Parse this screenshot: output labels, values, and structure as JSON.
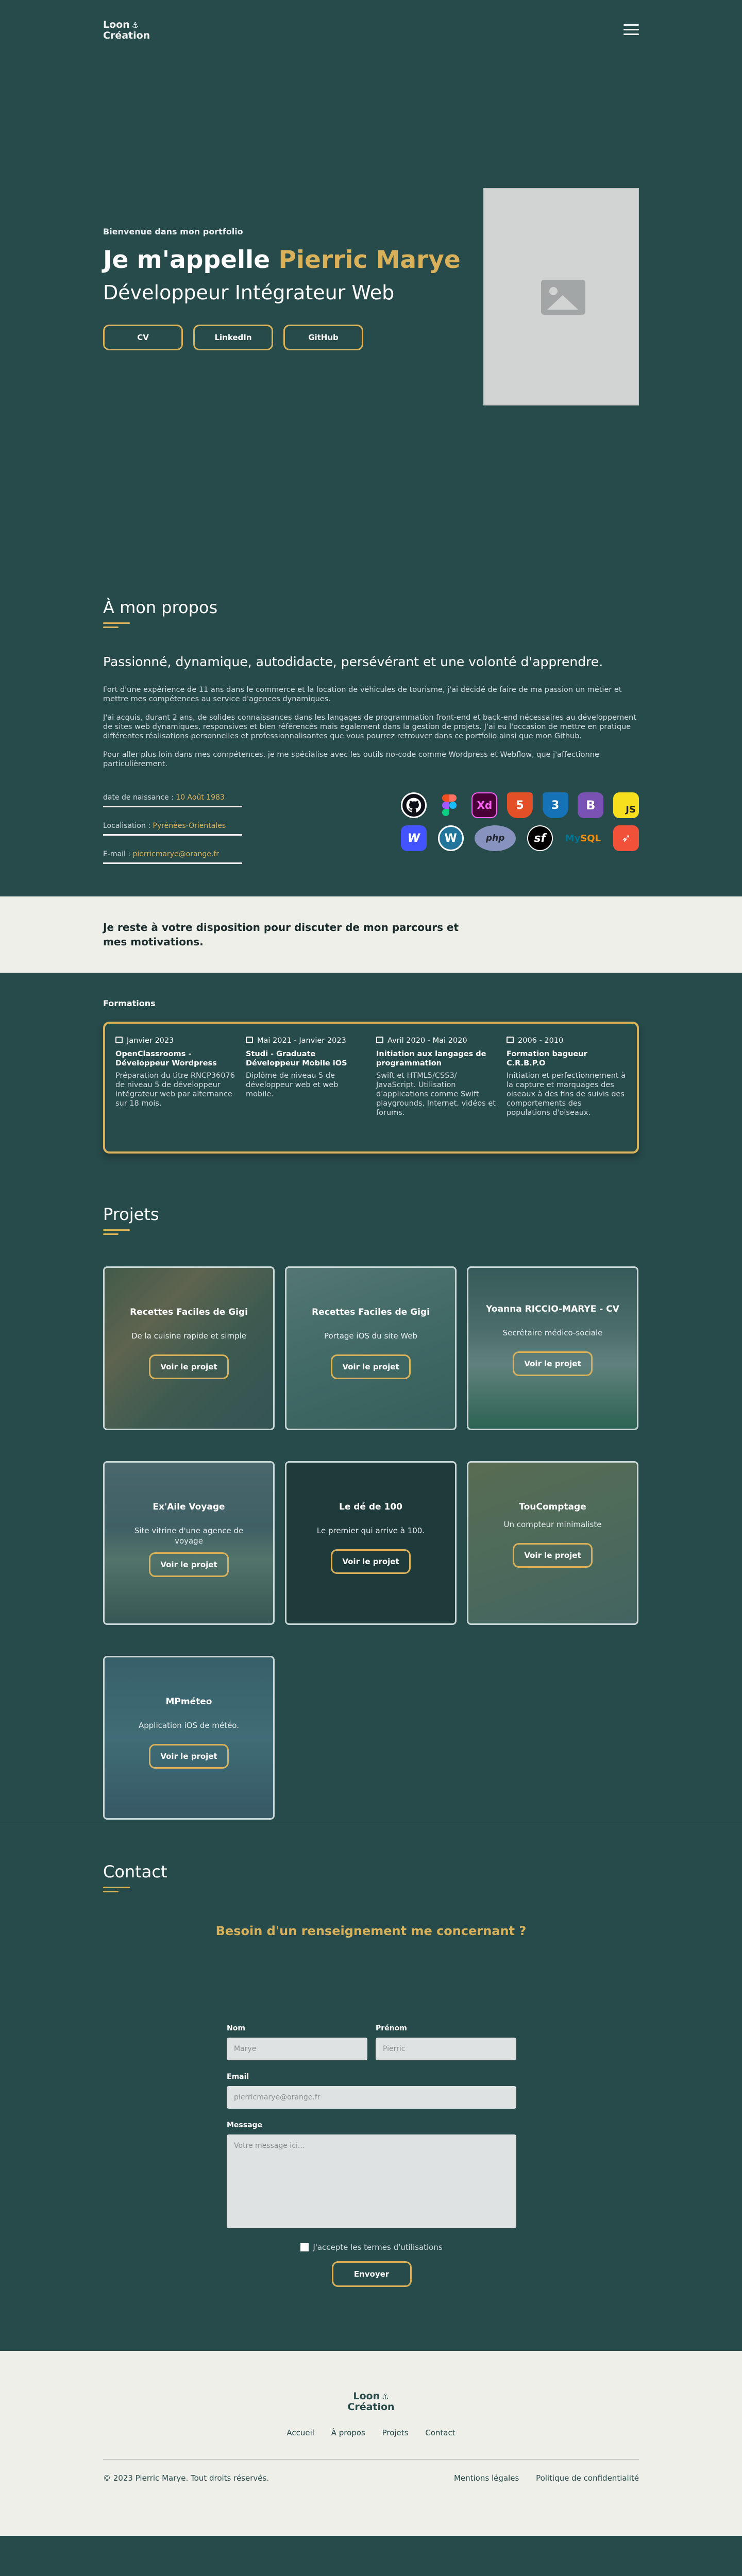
{
  "nav": {
    "logo_line1": "Loon",
    "logo_anchor": "⚓",
    "logo_line2": "Création"
  },
  "hero": {
    "intro": "Bienvenue dans mon portfolio",
    "name_prefix": "Je m'appelle",
    "name": "Pierric Marye",
    "role": "Développeur Intégrateur Web",
    "buttons": [
      "CV",
      "LinkedIn",
      "GitHub"
    ]
  },
  "about": {
    "title": "À mon propos",
    "tagline": "Passionné, dynamique, autodidacte, persévérant et une volonté d'apprendre.",
    "paragraphs": [
      "Fort d'une expérience de 11 ans dans le commerce et la location de véhicules de tourisme, j'ai décidé de faire de ma passion un métier et mettre mes compétences au service d'agences dynamiques.",
      "J'ai acquis, durant 2 ans, de solides connaissances dans les langages de programmation front-end et back-end nécessaires au développement de sites web dynamiques, responsives et bien référencés mais également dans la gestion de projets. J'ai eu l'occasion de mettre en pratique différentes réalisations personnelles et professionnalisantes que vous pourrez retrouver dans ce portfolio ainsi que mon Github.",
      "Pour aller plus loin dans mes compétences, je me spécialise avec les outils no-code comme Wordpress et Webflow, que j'affectionne particulièrement."
    ],
    "facts": [
      {
        "label": "date de naissance :",
        "value": "10 Août 1983"
      },
      {
        "label": "Localisation :",
        "value": "Pyrénées-Orientales"
      },
      {
        "label": "E-mail :",
        "value": "pierricmarye@orange.fr"
      }
    ],
    "tech_icons": [
      "github-icon",
      "figma-icon",
      "adobe-xd-icon",
      "html5-icon",
      "css3-icon",
      "bootstrap-icon",
      "javascript-icon",
      "webflow-icon",
      "wordpress-icon",
      "php-icon",
      "symfony-icon",
      "mysql-icon",
      "swift-icon"
    ]
  },
  "banner": {
    "text": "Je reste à votre disposition pour discuter de mon parcours et mes motivations."
  },
  "formations": {
    "title": "Formations",
    "items": [
      {
        "date": "Janvier 2023",
        "name": "OpenClassrooms - Développeur Wordpress",
        "desc": "Préparation du titre RNCP36076 de niveau 5 de développeur intégrateur web par alternance sur 18 mois."
      },
      {
        "date": "Mai 2021 - Janvier 2023",
        "name": "Studi - Graduate Développeur Mobile iOS",
        "desc": "Diplôme de niveau 5 de développeur web et web mobile."
      },
      {
        "date": "Avril 2020 - Mai 2020",
        "name": "Initiation aux langages de programmation",
        "desc": "Swift et HTML5/CSS3/ JavaScript. Utilisation d'applications comme Swift playgrounds, Internet, vidéos et forums."
      },
      {
        "date": "2006 - 2010",
        "name": "Formation bagueur C.R.B.P.O",
        "desc": "Initiation et perfectionnement à la capture et marquages des oiseaux à des fins de suivis des comportements des populations d'oiseaux."
      }
    ]
  },
  "projects": {
    "title": "Projets",
    "button_label": "Voir le projet",
    "items": [
      {
        "title": "Recettes Faciles de Gigi",
        "desc": "De la cuisine rapide et simple"
      },
      {
        "title": "Recettes Faciles de Gigi",
        "desc": "Portage iOS du site Web"
      },
      {
        "title": "Yoanna RICCIO-MARYE - CV",
        "desc": "Secrétaire médico-sociale"
      },
      {
        "title": "Ex'Aile Voyage",
        "desc": "Site vitrine d'une agence de voyage"
      },
      {
        "title": "Le dé de 100",
        "desc": "Le premier qui arrive à 100."
      },
      {
        "title": "TouComptage",
        "desc": "Un compteur minimaliste"
      },
      {
        "title": "MPméteo",
        "desc": "Application iOS de météo."
      }
    ]
  },
  "contact": {
    "title": "Contact",
    "question": "Besoin d'un renseignement me concernant ?",
    "nom_label": "Nom",
    "nom_placeholder": "Marye",
    "prenom_label": "Prénom",
    "prenom_placeholder": "Pierric",
    "email_label": "Email",
    "email_placeholder": "pierricmarye@orange.fr",
    "message_label": "Message",
    "message_placeholder": "Votre message ici...",
    "terms": "J'accepte les termes d'utilisations",
    "submit": "Envoyer"
  },
  "footer": {
    "links": [
      "Accueil",
      "À propos",
      "Projets",
      "Contact"
    ],
    "copyright": "© 2023 Pierric Marye. Tout droits réservés.",
    "legal": [
      "Mentions légales",
      "Politique de confidentialité"
    ]
  },
  "colors": {
    "bg": "#274a4b",
    "accent": "#d8b15a",
    "light": "#efefea"
  }
}
